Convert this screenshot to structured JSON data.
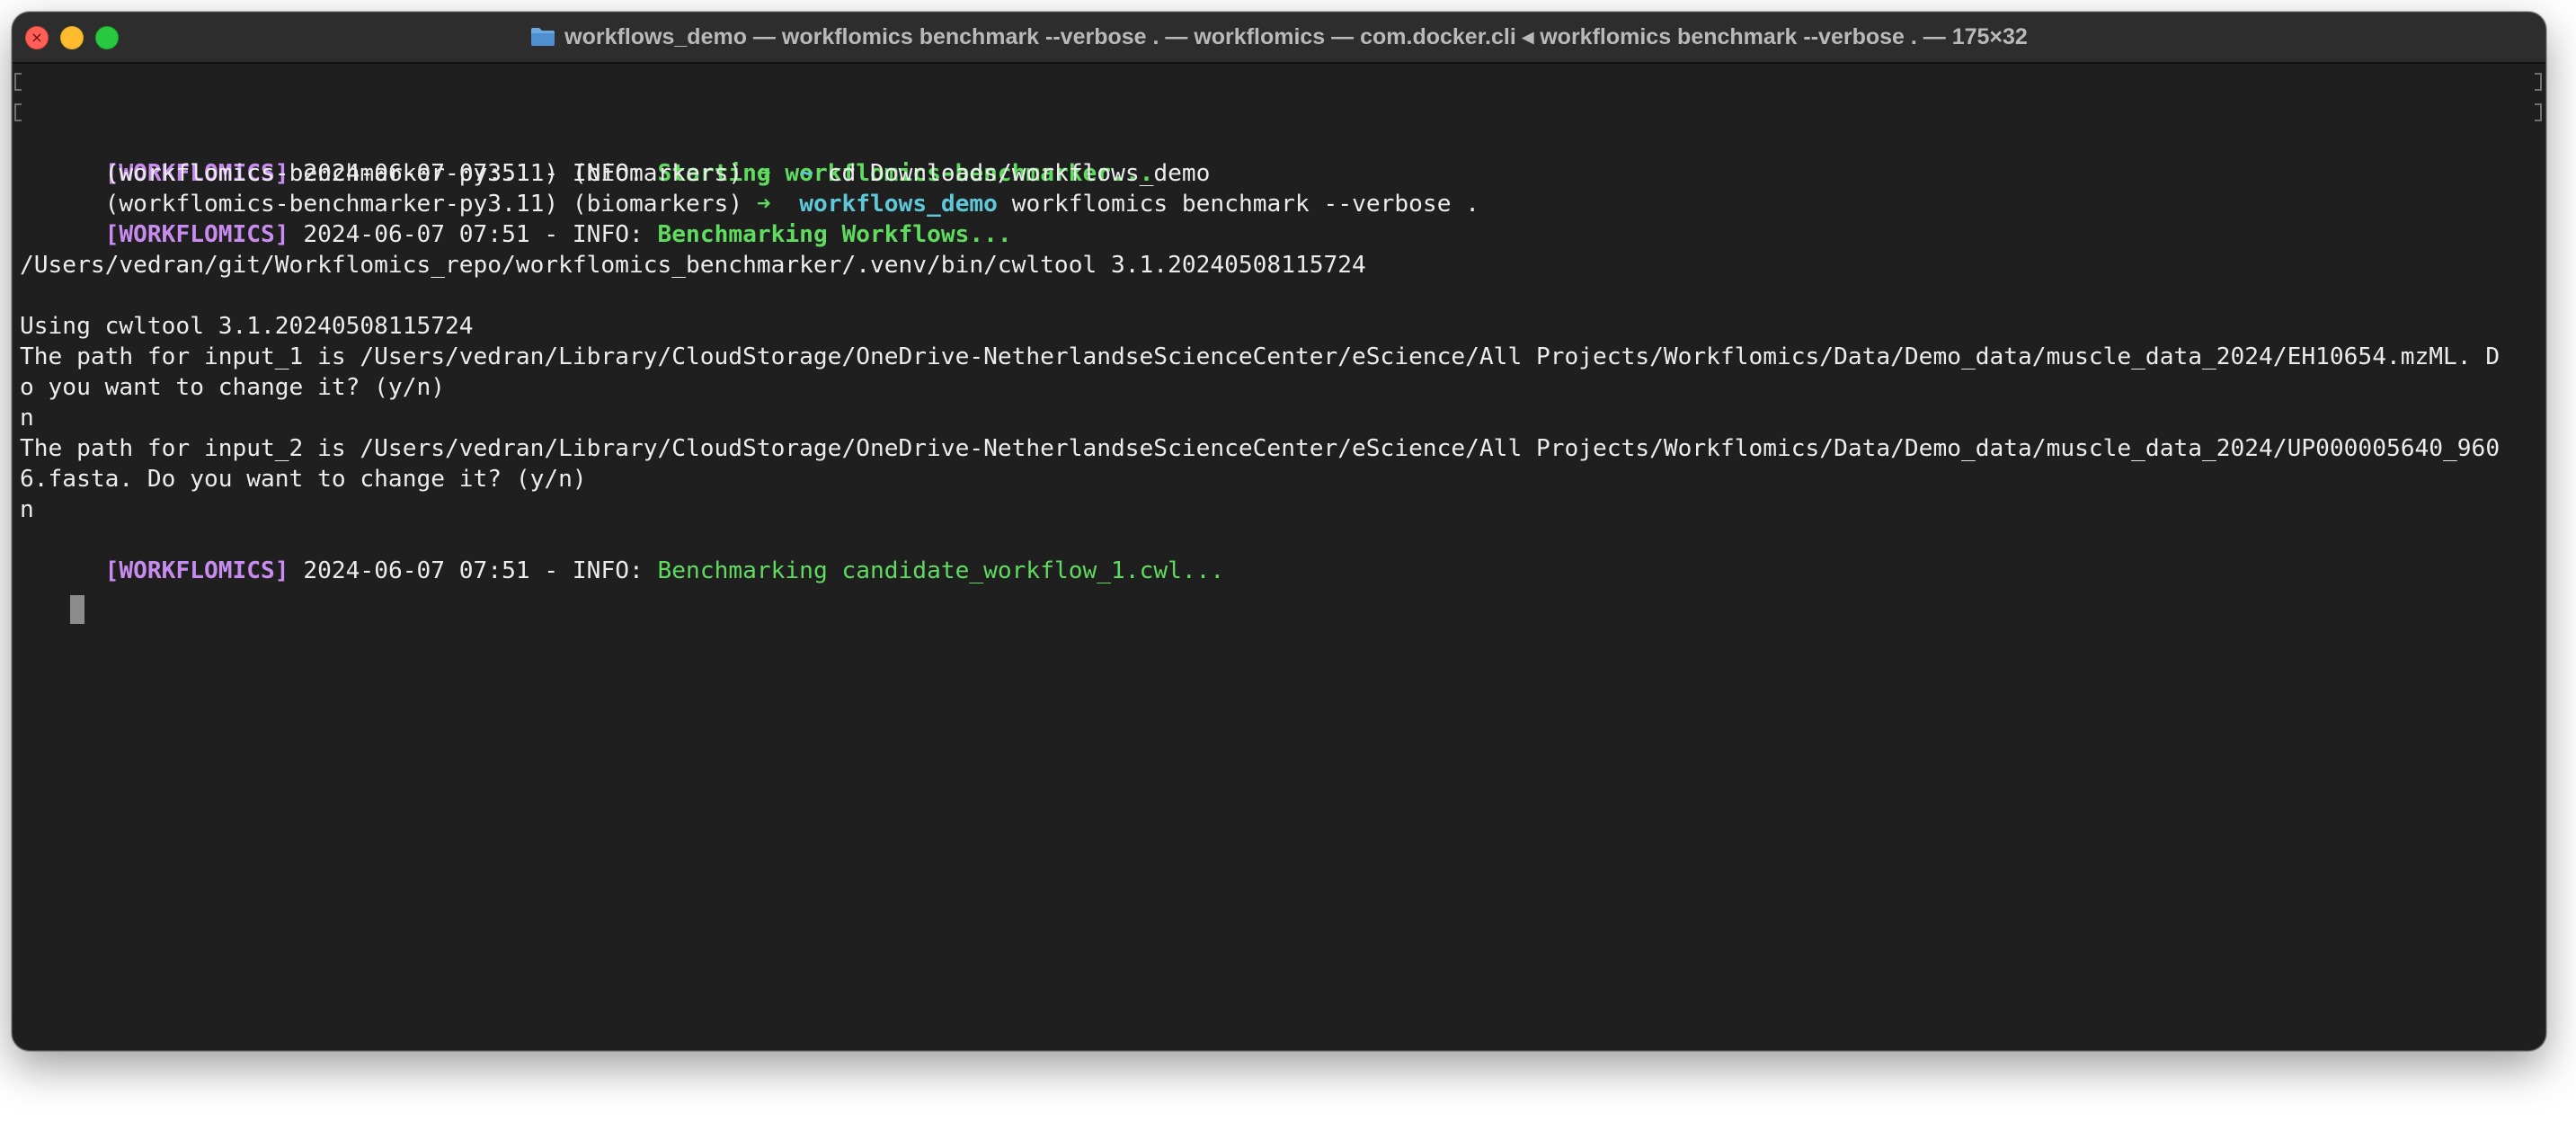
{
  "window": {
    "title": "workflows_demo — workflomics benchmark --verbose . — workflomics — com.docker.cli ◂ workflomics benchmark --verbose . — 175×32"
  },
  "colors": {
    "terminal_bg": "#1f1f1f",
    "tag": "#c88cf0",
    "green": "#5fdb5f",
    "cyan": "#5ec8d8",
    "text": "#ececec"
  },
  "prompt": {
    "env": "(workflomics-benchmarker-py3.11) (biomarkers) ",
    "arrow": "➜",
    "home": "~",
    "cmd1": "cd Downloads/workflows_demo",
    "dir": "workflows_demo",
    "cmd2": "workflomics benchmark --verbose ."
  },
  "log": {
    "tag": "[WORKFLOMICS]",
    "prefix": "2024-06-07 07:51 - INFO: ",
    "starting": "Starting workflomics-benchmarker...",
    "benchmarking": "Benchmarking Workflows...",
    "candidate": "Benchmarking candidate_workflow_1.cwl..."
  },
  "output": {
    "cwltool_path": "/Users/vedran/git/Workflomics_repo/workflomics_benchmarker/.venv/bin/cwltool 3.1.20240508115724",
    "using": "Using cwltool 3.1.20240508115724",
    "input1_a": "The path for input_1 is /Users/vedran/Library/CloudStorage/OneDrive-NetherlandseScienceCenter/eScience/All Projects/Workflomics/Data/Demo_data/muscle_data_2024/EH10654.mzML. D",
    "input1_b": "o you want to change it? (y/n)",
    "answer1": "n",
    "input2_a": "The path for input_2 is /Users/vedran/Library/CloudStorage/OneDrive-NetherlandseScienceCenter/eScience/All Projects/Workflomics/Data/Demo_data/muscle_data_2024/UP000005640_960",
    "input2_b": "6.fasta. Do you want to change it? (y/n)",
    "answer2": "n"
  },
  "icons": {
    "close": "close-icon",
    "minimize": "minimize-icon",
    "maximize": "maximize-icon",
    "folder": "folder-icon"
  }
}
